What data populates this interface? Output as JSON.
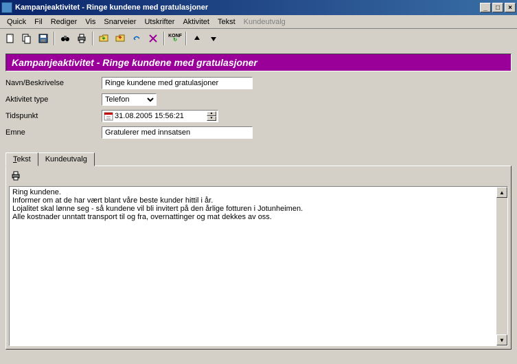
{
  "window": {
    "title": "Kampanjeaktivitet - Ringe kundene med gratulasjoner"
  },
  "menu": {
    "quick": "Quick",
    "fil": "Fil",
    "rediger": "Rediger",
    "vis": "Vis",
    "snarveier": "Snarveier",
    "utskrifter": "Utskrifter",
    "aktivitet": "Aktivitet",
    "tekst": "Tekst",
    "kundeutvalg": "Kundeutvalg"
  },
  "toolbar_icons": {
    "new": "new-icon",
    "copy": "copy-icon",
    "save": "save-icon",
    "find": "find-icon",
    "print": "print-icon",
    "folder_in": "folder-in-icon",
    "folder_out": "folder-out-icon",
    "undo": "undo-icon",
    "delete": "delete-icon",
    "konf": "KONF",
    "up": "up-icon",
    "down": "down-icon"
  },
  "banner": "Kampanjeaktivitet - Ringe kundene med gratulasjoner",
  "form": {
    "name_label": "Navn/Beskrivelse",
    "name_value": "Ringe kundene med gratulasjoner",
    "type_label": "Aktivitet type",
    "type_value": "Telefon",
    "time_label": "Tidspunkt",
    "time_value": "31.08.2005 15:56:21",
    "subject_label": "Emne",
    "subject_value": "Gratulerer med innsatsen"
  },
  "tabs": {
    "tekst_u": "T",
    "tekst_rest": "ekst",
    "kundeutvalg": "Kundeutvalg"
  },
  "text_content": "Ring kundene.\nInformer om at de har vært blant våre beste kunder hittil i år.\nLojalitet skal lønne seg - så kundene vil bli invitert på den årlige fotturen i Jotunheimen.\nAlle kostnader unntatt transport til og fra, overnattinger og mat dekkes av oss."
}
